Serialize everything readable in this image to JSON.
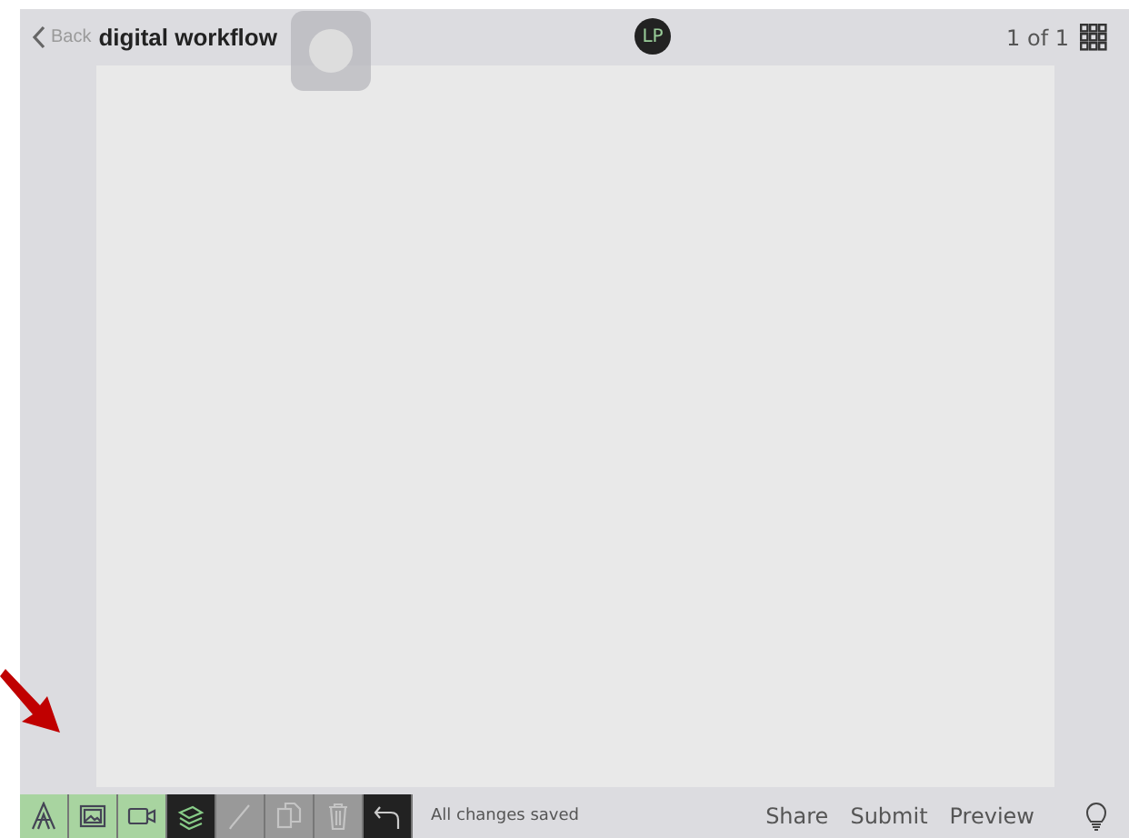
{
  "header": {
    "back": "Back",
    "title": "digital workflow",
    "avatar": "LP",
    "page_count": "1 of 1"
  },
  "toolbar": {
    "tools": [
      {
        "kind": "insert",
        "disabled": false
      },
      {
        "kind": "insert",
        "disabled": false
      },
      {
        "kind": "insert",
        "disabled": false
      },
      {
        "kind": "action",
        "disabled": false
      },
      {
        "kind": "action",
        "disabled": true
      },
      {
        "kind": "action",
        "disabled": true
      },
      {
        "kind": "action",
        "disabled": true
      },
      {
        "kind": "action",
        "disabled": false
      }
    ],
    "status": "All changes saved",
    "links": [
      "Share",
      "Submit",
      "Preview"
    ]
  }
}
